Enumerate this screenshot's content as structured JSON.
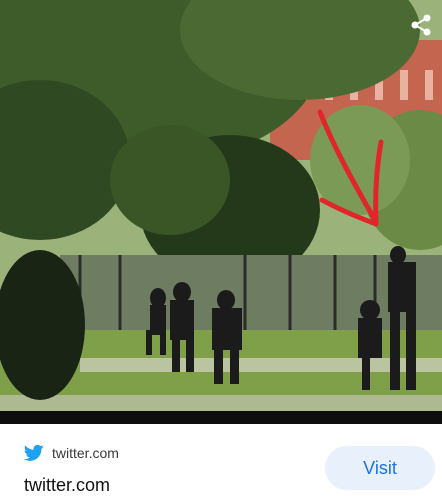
{
  "card": {
    "source_domain": "twitter.com",
    "title": "twitter.com",
    "visit_label": "Visit",
    "icons": {
      "source": "twitter-bird-icon",
      "share": "share-icon"
    },
    "colors": {
      "accent": "#1a73e8",
      "visit_bg": "#e8f0fb",
      "twitter_blue": "#1da1f2",
      "arrow_red": "#e0262a"
    }
  }
}
